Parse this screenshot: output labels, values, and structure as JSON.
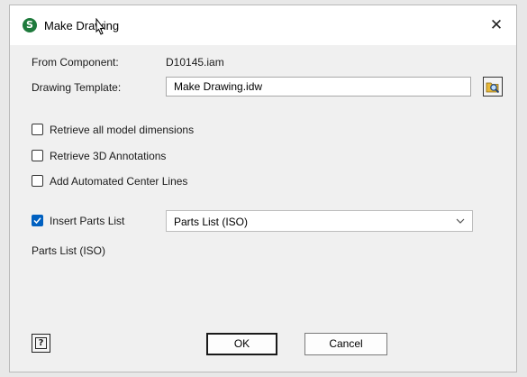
{
  "window": {
    "title": "Make Drawing",
    "app_icon_letter": "S",
    "close_glyph": "✕"
  },
  "form": {
    "from_component_label": "From Component:",
    "from_component_value": "D10145.iam",
    "drawing_template_label": "Drawing Template:",
    "drawing_template_value": "Make Drawing.idw"
  },
  "options": [
    {
      "label": "Retrieve all model dimensions",
      "checked": false
    },
    {
      "label": "Retrieve 3D Annotations",
      "checked": false
    },
    {
      "label": "Add Automated Center Lines",
      "checked": false
    }
  ],
  "parts_list": {
    "insert_label": "Insert Parts List",
    "insert_checked": true,
    "selected_style": "Parts List (ISO)",
    "style_caption": "Parts List (ISO)"
  },
  "footer": {
    "help_glyph": "?",
    "ok_label": "OK",
    "cancel_label": "Cancel"
  },
  "colors": {
    "accent": "#0060c0",
    "app_icon": "#1e7a3c"
  }
}
